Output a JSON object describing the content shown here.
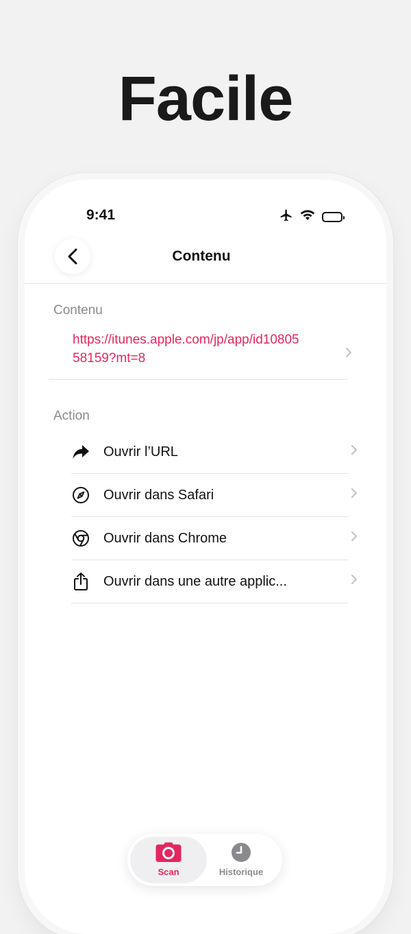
{
  "headline": "Facile",
  "status_bar": {
    "time": "9:41"
  },
  "navbar": {
    "title": "Contenu"
  },
  "content_section": {
    "label": "Contenu",
    "url": "https://itunes.apple.com/jp/app/id1080558159?mt=8"
  },
  "action_section": {
    "label": "Action",
    "items": [
      {
        "label": "Ouvrir l’URL",
        "icon": "share-arrow-icon"
      },
      {
        "label": "Ouvrir dans Safari",
        "icon": "compass-icon"
      },
      {
        "label": "Ouvrir dans Chrome",
        "icon": "chrome-icon"
      },
      {
        "label": "Ouvrir dans une autre applic...",
        "icon": "share-box-icon"
      }
    ]
  },
  "tabbar": {
    "scan_label": "Scan",
    "history_label": "Historique"
  },
  "colors": {
    "accent": "#e4265f",
    "muted": "#8a8a8e"
  }
}
